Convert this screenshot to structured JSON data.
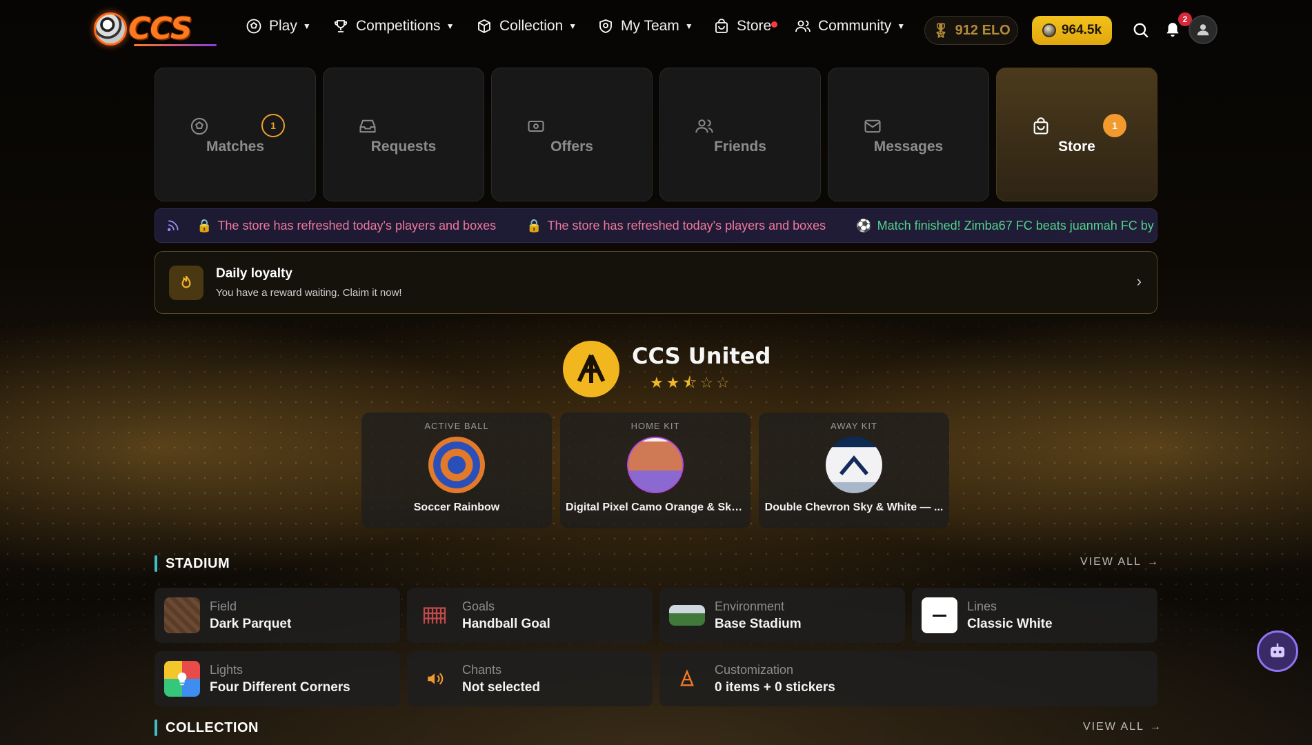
{
  "brand": {
    "name": "CCS",
    "accent": "#ff7a1f"
  },
  "nav": {
    "items": [
      {
        "label": "Play",
        "icon": "soccer-ball-icon"
      },
      {
        "label": "Competitions",
        "icon": "trophy-icon"
      },
      {
        "label": "Collection",
        "icon": "box-icon"
      },
      {
        "label": "My Team",
        "icon": "shield-icon"
      },
      {
        "label": "Store",
        "icon": "shopping-bag-icon"
      },
      {
        "label": "Community",
        "icon": "users-icon"
      }
    ],
    "elo": "912 ELO",
    "coins": "964.5k",
    "notifications": "2"
  },
  "tabs": [
    {
      "label": "Matches",
      "badge": "1",
      "icon": "soccer-ball-icon"
    },
    {
      "label": "Requests",
      "icon": "inbox-icon"
    },
    {
      "label": "Offers",
      "icon": "ticket-icon"
    },
    {
      "label": "Friends",
      "icon": "users-icon"
    },
    {
      "label": "Messages",
      "icon": "mail-icon"
    },
    {
      "label": "Store",
      "badge": "1",
      "icon": "shopping-bag-icon"
    }
  ],
  "ticker": {
    "items": [
      {
        "type": "store",
        "text": "The store has refreshed today's players and boxes"
      },
      {
        "type": "store",
        "text": "The store has refreshed today's players and boxes"
      },
      {
        "type": "match",
        "text": "Match finished! Zimba67 FC beats juanmah FC by"
      }
    ]
  },
  "daily": {
    "title": "Daily loyalty",
    "subtitle": "You have a reward waiting. Claim it now!"
  },
  "team": {
    "name": "CCS United",
    "rating": 2.5,
    "max_rating": 5
  },
  "kits": [
    {
      "label": "ACTIVE BALL",
      "name": "Soccer Rainbow"
    },
    {
      "label": "HOME KIT",
      "name": "Digital Pixel Camo Orange & Sky ..."
    },
    {
      "label": "AWAY KIT",
      "name": "Double Chevron Sky & White — ..."
    }
  ],
  "stadium": {
    "title": "STADIUM",
    "view_all": "VIEW ALL",
    "items": [
      {
        "label": "Field",
        "value": "Dark Parquet"
      },
      {
        "label": "Goals",
        "value": "Handball Goal"
      },
      {
        "label": "Environment",
        "value": "Base Stadium"
      },
      {
        "label": "Lines",
        "value": "Classic White"
      },
      {
        "label": "Lights",
        "value": "Four Different Corners"
      },
      {
        "label": "Chants",
        "value": "Not selected"
      },
      {
        "label": "Customization",
        "value": "0 items + 0 stickers"
      }
    ]
  },
  "collection": {
    "title": "COLLECTION",
    "view_all": "VIEW ALL"
  }
}
